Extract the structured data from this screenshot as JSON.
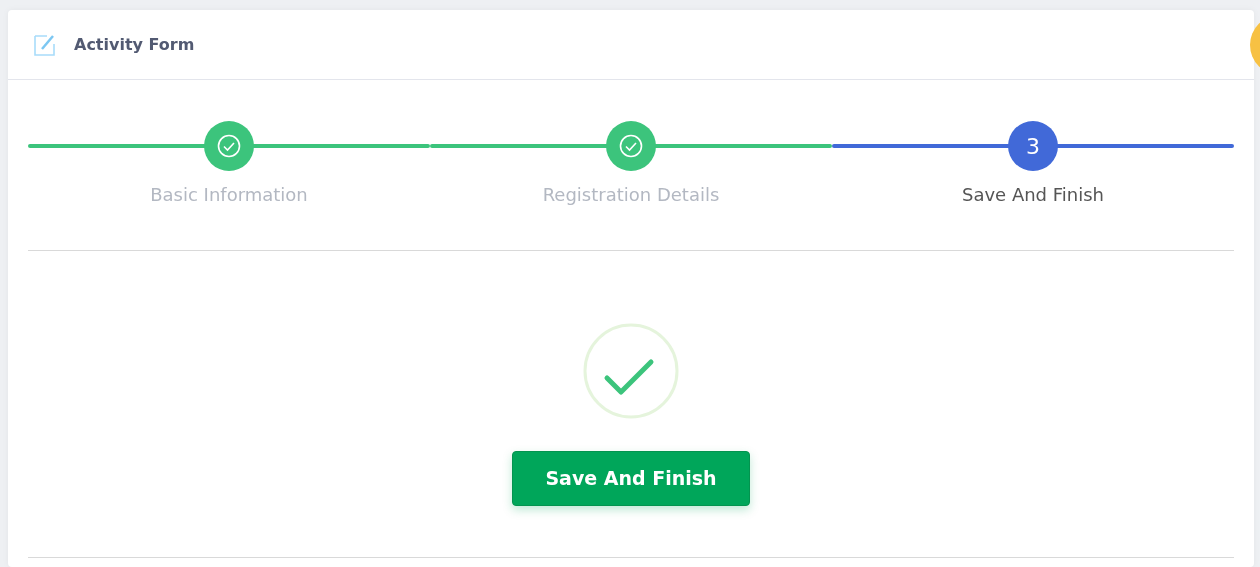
{
  "card": {
    "title": "Activity Form"
  },
  "steps": [
    {
      "label": "Basic Information",
      "completed": true,
      "selected": false
    },
    {
      "label": "Registration Details",
      "completed": true,
      "selected": false
    },
    {
      "label": "Save And Finish",
      "completed": false,
      "selected": true,
      "number": "3"
    }
  ],
  "result": {
    "kind": "success",
    "button": "Save And Finish"
  }
}
